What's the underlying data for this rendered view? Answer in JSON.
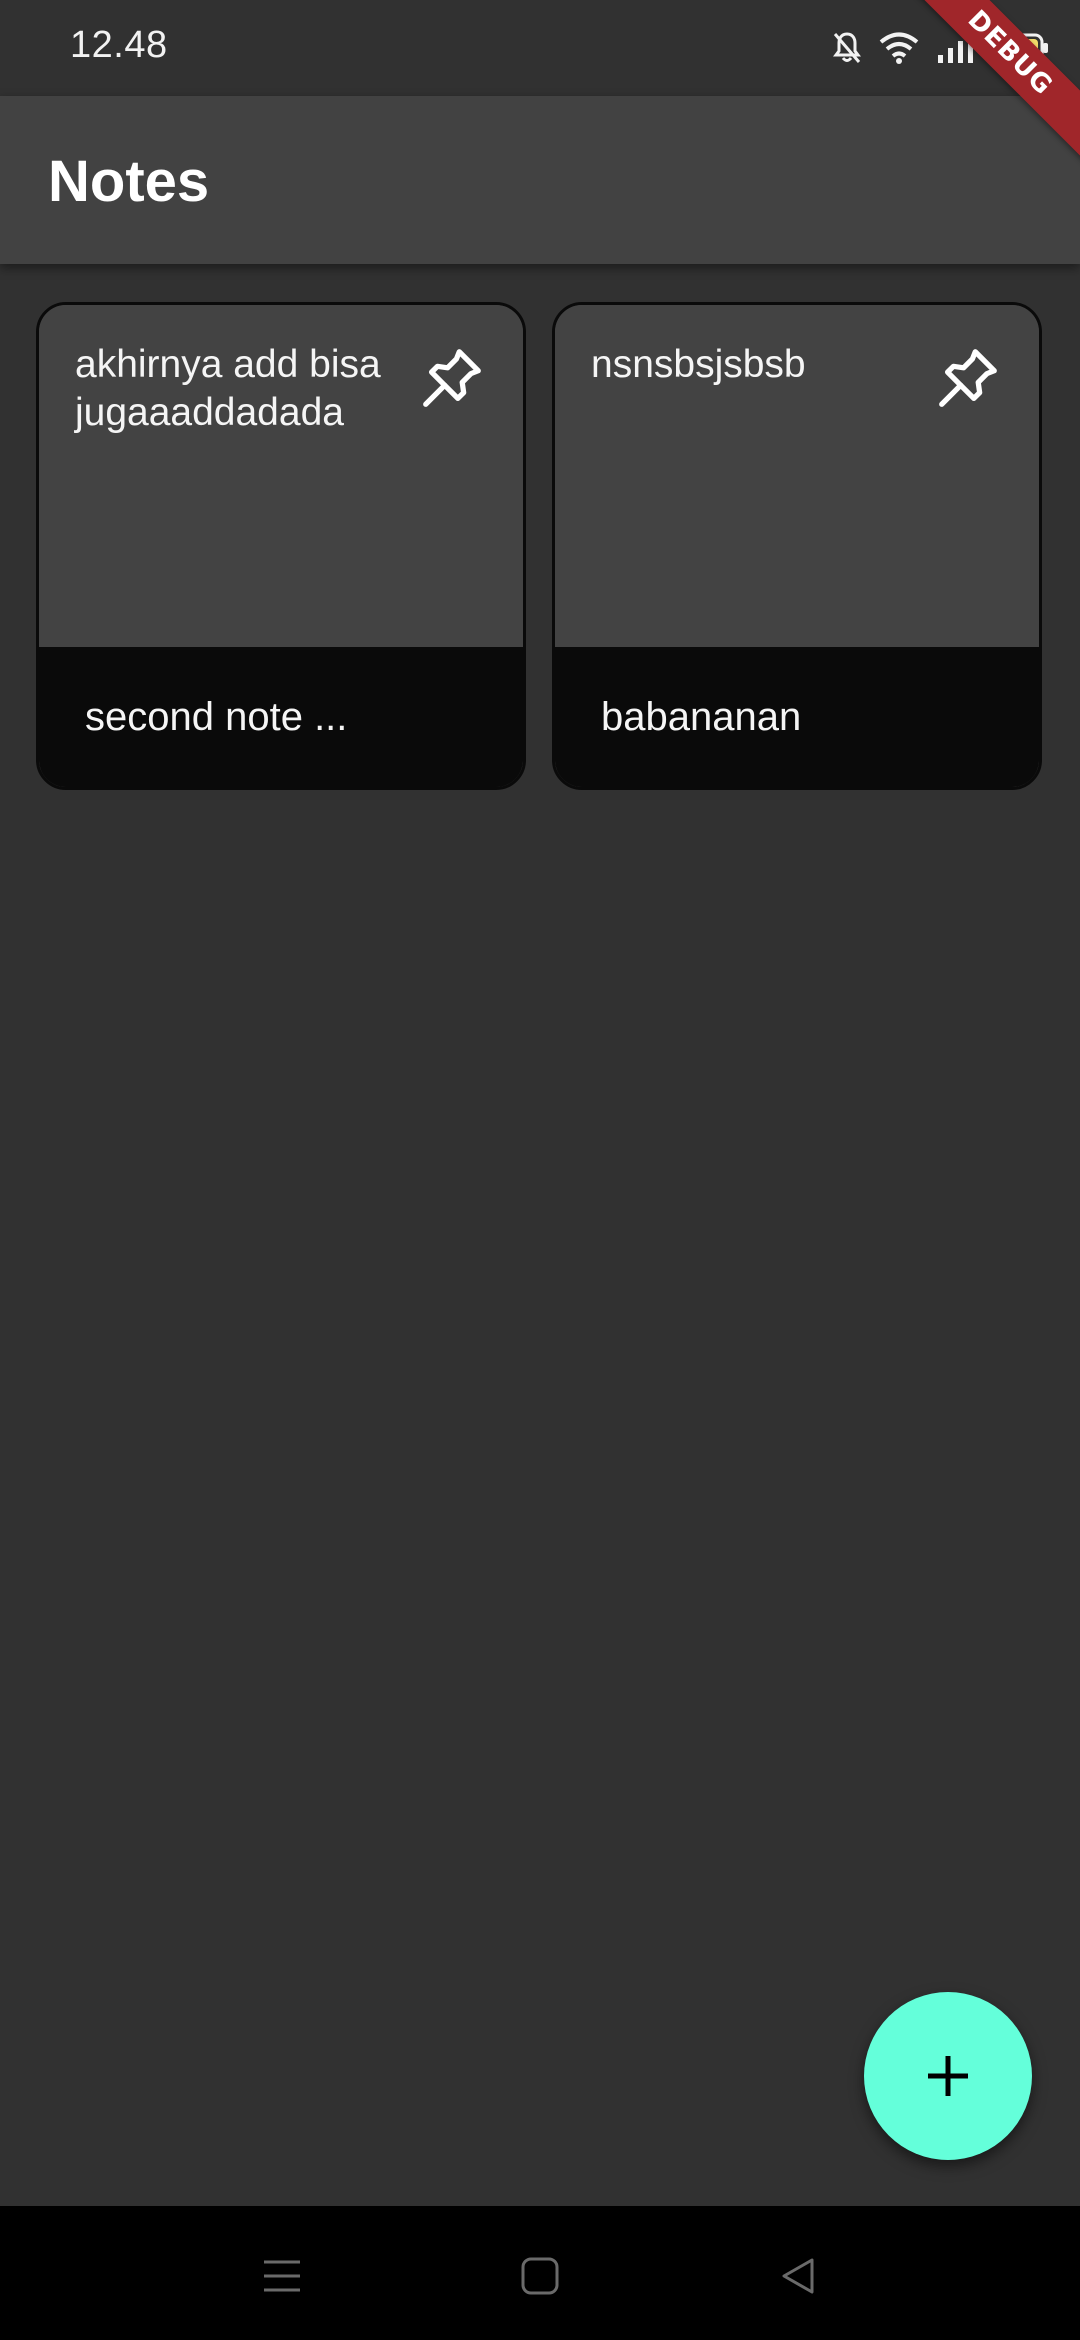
{
  "status_bar": {
    "time": "12.48",
    "icons": [
      "notifications-off-icon",
      "wifi-icon",
      "signal-icon",
      "battery-icon"
    ]
  },
  "debug_banner": {
    "label": "DEBUG"
  },
  "app_bar": {
    "title": "Notes"
  },
  "notes": [
    {
      "title": "akhirnya add bisa jugaaaddadada",
      "subtitle": "second note ...",
      "pin_icon": "pin-icon"
    },
    {
      "title": "nsnsbsjsbsb",
      "subtitle": "babananan",
      "pin_icon": "pin-icon"
    }
  ],
  "fab": {
    "icon": "add-icon",
    "color": "#64ffda"
  },
  "nav_bar": {
    "buttons": [
      "menu-icon",
      "home-icon",
      "back-icon"
    ]
  },
  "colors": {
    "background": "#313131",
    "app_bar": "#424242",
    "card_top": "#434343",
    "card_bottom": "#0a0a0a",
    "accent": "#64ffda",
    "debug": "#a0262a"
  }
}
